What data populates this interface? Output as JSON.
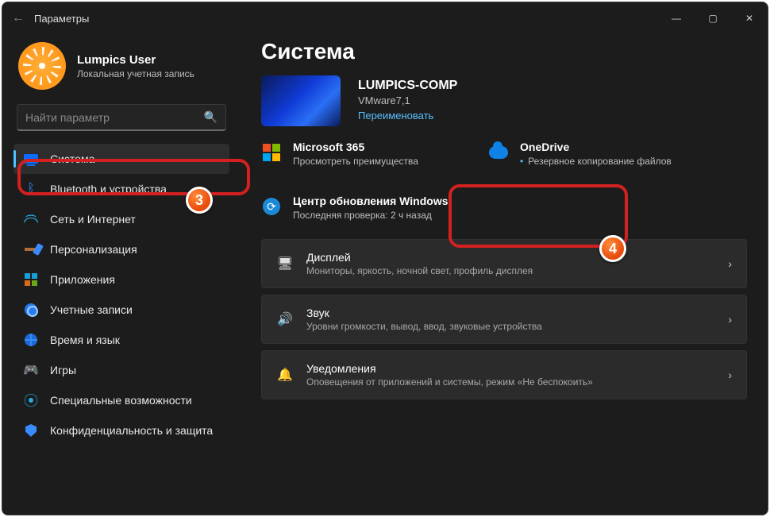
{
  "window": {
    "title": "Параметры"
  },
  "profile": {
    "name": "Lumpics User",
    "sub": "Локальная учетная запись"
  },
  "search": {
    "placeholder": "Найти параметр"
  },
  "nav": [
    {
      "label": "Система",
      "icon": "monitor",
      "selected": true
    },
    {
      "label": "Bluetooth и устройства",
      "icon": "bt"
    },
    {
      "label": "Сеть и Интернет",
      "icon": "wifi"
    },
    {
      "label": "Персонализация",
      "icon": "brush"
    },
    {
      "label": "Приложения",
      "icon": "apps"
    },
    {
      "label": "Учетные записи",
      "icon": "user"
    },
    {
      "label": "Время и язык",
      "icon": "globe"
    },
    {
      "label": "Игры",
      "icon": "game"
    },
    {
      "label": "Специальные возможности",
      "icon": "access"
    },
    {
      "label": "Конфиденциальность и защита",
      "icon": "shield"
    }
  ],
  "page": {
    "title": "Система"
  },
  "device": {
    "name": "LUMPICS-COMP",
    "model": "VMware7,1",
    "rename": "Переименовать"
  },
  "tiles": {
    "ms365": {
      "title": "Microsoft 365",
      "sub": "Просмотреть преимущества"
    },
    "onedrive": {
      "title": "OneDrive",
      "sub": "Резервное копирование файлов"
    },
    "update": {
      "title": "Центр обновления Windows",
      "sub": "Последняя проверка: 2 ч назад"
    }
  },
  "cards": {
    "display": {
      "title": "Дисплей",
      "sub": "Мониторы, яркость, ночной свет, профиль дисплея"
    },
    "sound": {
      "title": "Звук",
      "sub": "Уровни громкости, вывод, ввод, звуковые устройства"
    },
    "notify": {
      "title": "Уведомления",
      "sub": "Оповещения от приложений и системы, режим «Не беспокоить»"
    }
  },
  "annotations": {
    "b3": "3",
    "b4": "4"
  }
}
